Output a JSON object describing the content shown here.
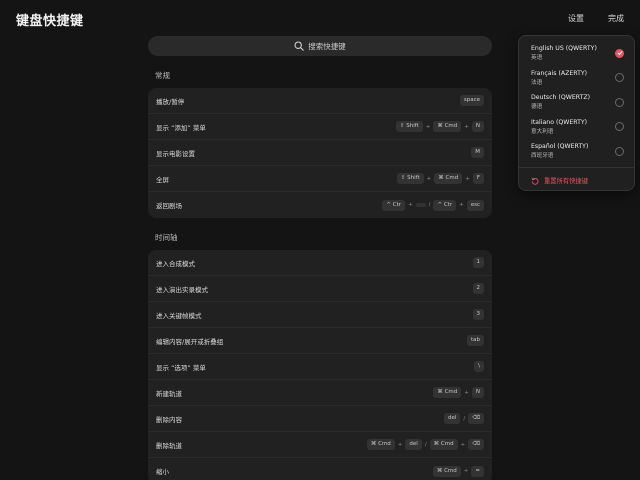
{
  "header": {
    "title": "键盘快捷键",
    "settings_label": "设置",
    "done_label": "完成"
  },
  "search": {
    "placeholder": "搜索快捷键"
  },
  "sections": [
    {
      "title": "常规",
      "rows": [
        {
          "label": "播放/暂停",
          "keys": [
            "space"
          ]
        },
        {
          "label": "显示 “添加” 菜单",
          "keys": [
            "⇧ Shift",
            "+",
            "⌘ Cmd",
            "+",
            "N"
          ]
        },
        {
          "label": "显示电影设置",
          "keys": [
            "M"
          ]
        },
        {
          "label": "全屏",
          "keys": [
            "⇧ Shift",
            "+",
            "⌘ Cmd",
            "+",
            "F"
          ]
        },
        {
          "label": "返回剧场",
          "keys": [
            "^ Ctr",
            "+",
            "",
            "/",
            "^ Ctr",
            "+",
            "esc"
          ]
        }
      ]
    },
    {
      "title": "时间轴",
      "rows": [
        {
          "label": "进入合成模式",
          "keys": [
            "1"
          ]
        },
        {
          "label": "进入演出实录模式",
          "keys": [
            "2"
          ]
        },
        {
          "label": "进入关键帧模式",
          "keys": [
            "3"
          ]
        },
        {
          "label": "编辑内容/展开或折叠组",
          "keys": [
            "tab"
          ]
        },
        {
          "label": "显示 “选项” 菜单",
          "keys": [
            "\\"
          ]
        },
        {
          "label": "新建轨道",
          "keys": [
            "⌘ Cmd",
            "+",
            "N"
          ]
        },
        {
          "label": "删除内容",
          "keys": [
            "del",
            "/",
            "⌫"
          ]
        },
        {
          "label": "删除轨道",
          "keys": [
            "⌘ Cmd",
            "+",
            "del",
            "/",
            "⌘ Cmd",
            "+",
            "⌫"
          ]
        },
        {
          "label": "缩小",
          "keys": [
            "⌘ Cmd",
            "+",
            "="
          ]
        }
      ]
    }
  ],
  "layout_menu": {
    "options": [
      {
        "name": "English US (QWERTY)",
        "sub": "英语",
        "selected": true
      },
      {
        "name": "Français (AZERTY)",
        "sub": "法语",
        "selected": false
      },
      {
        "name": "Deutsch (QWERTZ)",
        "sub": "德语",
        "selected": false
      },
      {
        "name": "Italiano (QWERTY)",
        "sub": "意大利语",
        "selected": false
      },
      {
        "name": "Español (QWERTY)",
        "sub": "西班牙语",
        "selected": false
      }
    ],
    "reset_label": "重置所有快捷键"
  },
  "colors": {
    "accent": "#e25563",
    "background": "#141414",
    "card": "#212121"
  }
}
